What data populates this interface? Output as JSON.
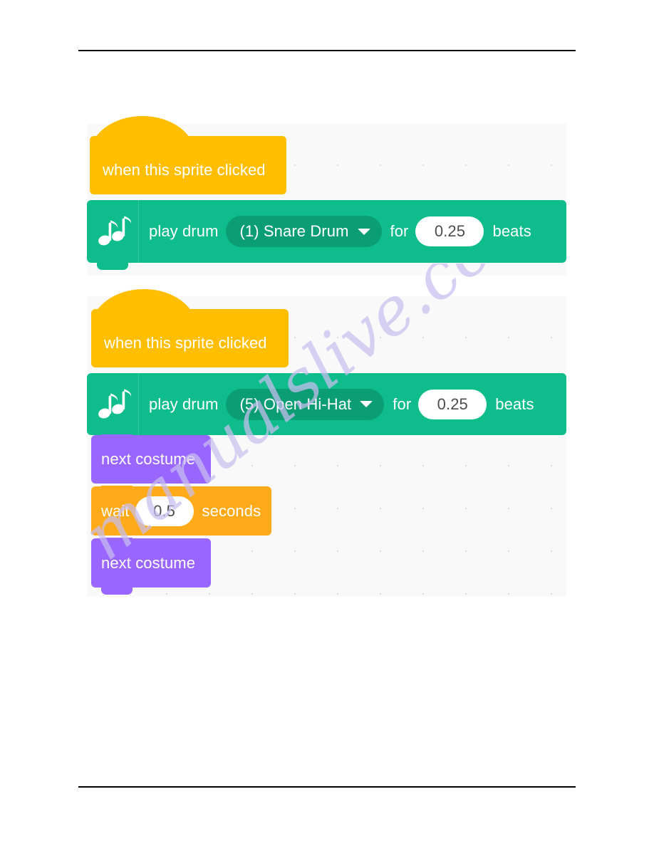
{
  "page": {
    "background_color": "#ffffff",
    "rule_color": "#000000",
    "watermark_text": "manualslive.com",
    "watermark_color": "#c9bff0"
  },
  "palette": {
    "events_yellow": "#ffbf00",
    "music_green": "#0fbd8c",
    "music_green_dark": "#0b9e74",
    "looks_purple": "#9966ff",
    "control_orange": "#ffab19",
    "canvas_background": "#f9f9f9",
    "grid_dot": "#dcdcdc",
    "block_text": "#ffffff",
    "input_text": "#4d4d4d"
  },
  "scripts": [
    {
      "id": "script-one",
      "blocks": [
        {
          "type": "hat",
          "category": "events",
          "label": "when this sprite clicked"
        },
        {
          "type": "command",
          "category": "music",
          "icon": "music-notes-icon",
          "label_before": "play drum",
          "dropdown_value": "(1) Snare Drum",
          "label_middle": "for",
          "number_value": "0.25",
          "label_after": "beats"
        }
      ]
    },
    {
      "id": "script-two",
      "blocks": [
        {
          "type": "hat",
          "category": "events",
          "label": "when this sprite clicked"
        },
        {
          "type": "command",
          "category": "music",
          "icon": "music-notes-icon",
          "label_before": "play drum",
          "dropdown_value": "(5) Open Hi-Hat",
          "label_middle": "for",
          "number_value": "0.25",
          "label_after": "beats"
        },
        {
          "type": "command",
          "category": "looks",
          "label": "next costume"
        },
        {
          "type": "command",
          "category": "control",
          "label_before": "wait",
          "number_value": "0.5",
          "label_after": "seconds"
        },
        {
          "type": "command",
          "category": "looks",
          "label": "next costume"
        }
      ]
    }
  ]
}
